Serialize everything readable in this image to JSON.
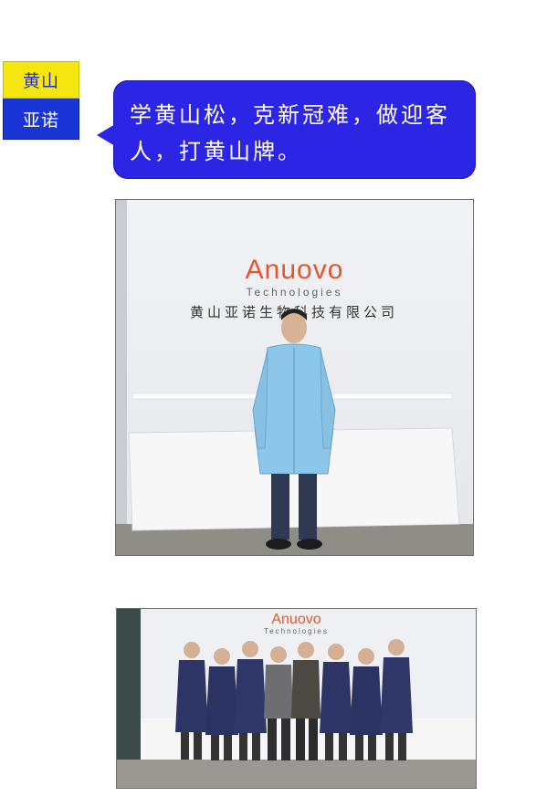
{
  "badge": {
    "top_text": "黄山",
    "bottom_text": "亚诺"
  },
  "bubble": {
    "text": "学黄山松，克新冠难，做迎客人，打黄山牌。"
  },
  "photo1": {
    "logo_brand": "Anuovo",
    "logo_sub": "Technologies",
    "company_name": "黄山亚诺生物科技有限公司"
  },
  "photo2": {
    "logo_brand": "Anuovo",
    "logo_sub": "Technologies"
  },
  "colors": {
    "badge_yellow": "#f5e60f",
    "badge_blue": "#1a35d6",
    "bubble_blue": "#2d25e6",
    "logo_orange": "#e6552d"
  }
}
